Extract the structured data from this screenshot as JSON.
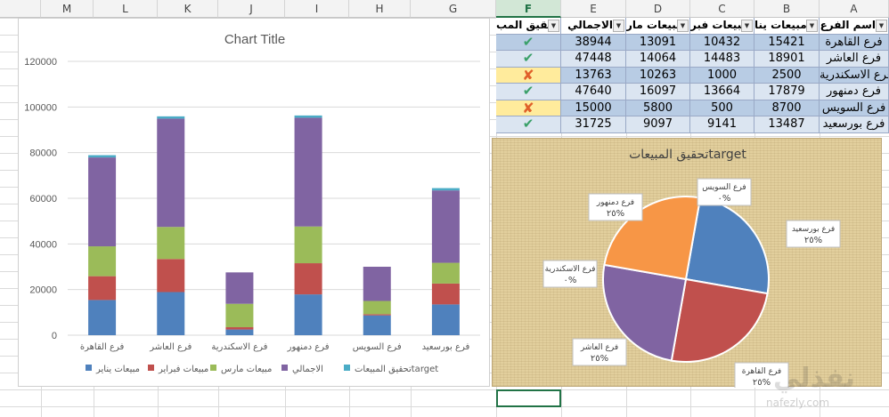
{
  "columns": [
    "M",
    "L",
    "K",
    "J",
    "I",
    "H",
    "G",
    "F",
    "E",
    "D",
    "C",
    "B",
    "A"
  ],
  "selected_column": "F",
  "table": {
    "headers": [
      "تحقيق المبيعات",
      "الاجمالي",
      "مبيعات مارس",
      "مبيعات فبراير",
      "مبيعات يناير",
      "اسم الفرع"
    ],
    "header_display": [
      "تحقيق المب",
      "الاجمالي",
      "مبيعات مار",
      "مبيعات فبر",
      "مبيعات ينا",
      "اسم الفرع"
    ],
    "rows": [
      {
        "branch": "فرع القاهرة",
        "jan": "15421",
        "feb": "10432",
        "mar": "13091",
        "total": "38944",
        "status": "check"
      },
      {
        "branch": "فرع العاشر",
        "jan": "18901",
        "feb": "14483",
        "mar": "14064",
        "total": "47448",
        "status": "check"
      },
      {
        "branch": "فرع الاسكندرية",
        "jan": "2500",
        "feb": "1000",
        "mar": "10263",
        "total": "13763",
        "status": "cross"
      },
      {
        "branch": "فرع دمنهور",
        "jan": "17879",
        "feb": "13664",
        "mar": "16097",
        "total": "47640",
        "status": "check"
      },
      {
        "branch": "فرع السويس",
        "jan": "8700",
        "feb": "500",
        "mar": "5800",
        "total": "15000",
        "status": "cross"
      },
      {
        "branch": "فرع بورسعيد",
        "jan": "13487",
        "feb": "9141",
        "mar": "9097",
        "total": "31725",
        "status": "check"
      }
    ]
  },
  "icons": {
    "check": "check-mark-icon",
    "cross": "cross-mark-icon",
    "dropdown": "dropdown-arrow-icon"
  },
  "chart_data": [
    {
      "type": "bar",
      "stacked": true,
      "title": "Chart Title",
      "categories": [
        "فرع القاهرة",
        "فرع العاشر",
        "فرع الاسكندرية",
        "فرع دمنهور",
        "فرع السويس",
        "فرع بورسعيد"
      ],
      "series": [
        {
          "name": "مبيعات يناير",
          "color": "#4f81bd",
          "values": [
            15421,
            18901,
            2500,
            17879,
            8700,
            13487
          ]
        },
        {
          "name": "مبيعات فبراير",
          "color": "#c0504d",
          "values": [
            10432,
            14483,
            1000,
            13664,
            500,
            9141
          ]
        },
        {
          "name": "مبيعات مارس",
          "color": "#9bbb59",
          "values": [
            13091,
            14064,
            10263,
            16097,
            5800,
            9097
          ]
        },
        {
          "name": "الاجمالي",
          "color": "#8064a2",
          "values": [
            38944,
            47448,
            13763,
            47640,
            15000,
            31725
          ]
        },
        {
          "name": "تحقيق المبيعاتtarget",
          "color": "#4bacc6",
          "values": [
            1000,
            1000,
            0,
            1000,
            0,
            1000
          ]
        }
      ],
      "ylim": [
        0,
        120000
      ],
      "yticks": [
        "0",
        "20000",
        "40000",
        "60000",
        "80000",
        "100000",
        "120000"
      ],
      "grid": true,
      "legend": "bottom"
    },
    {
      "type": "pie",
      "title": "تحقيق المبيعاتtarget",
      "labels": [
        "فرع القاهرة",
        "فرع العاشر",
        "فرع الاسكندرية",
        "فرع دمنهور",
        "فرع السويس",
        "فرع بورسعيد"
      ],
      "values": [
        25,
        25,
        0,
        25,
        0,
        25
      ],
      "colors": [
        "#4f81bd",
        "#c0504d",
        "#9bbb59",
        "#8064a2",
        "#4bacc6",
        "#f79646"
      ],
      "data_labels": [
        "٢٥%",
        "٢٥%",
        "٠%",
        "٢٥%",
        "٠%",
        "٢٥%"
      ]
    }
  ],
  "watermark": {
    "logo": "نفذلي",
    "url": "nafezly.com"
  }
}
